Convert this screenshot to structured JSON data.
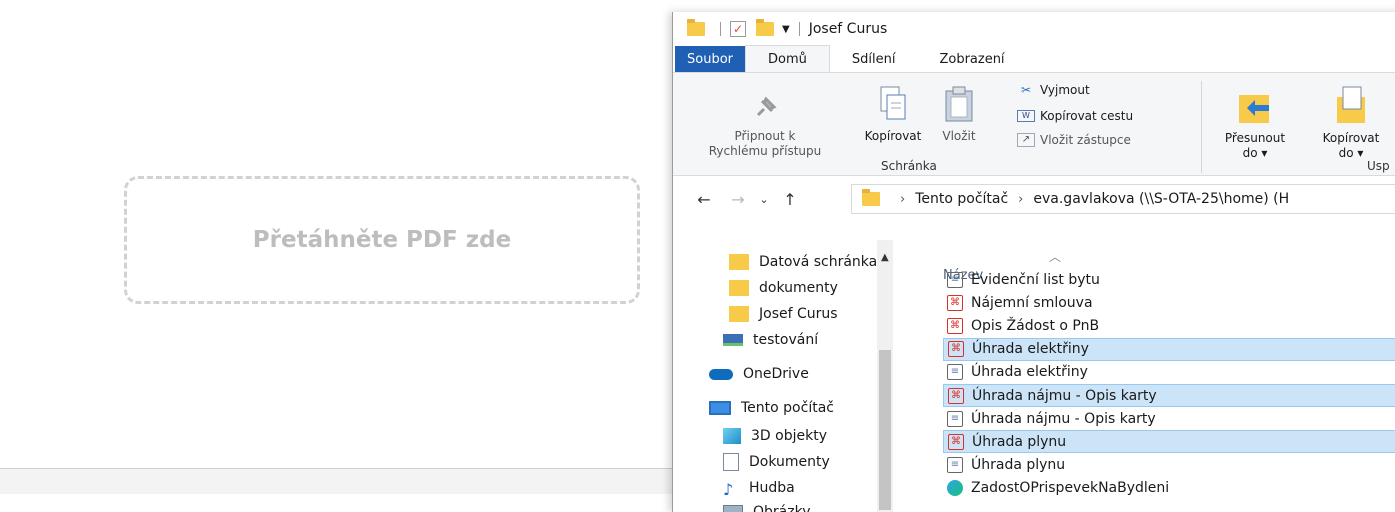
{
  "page": {
    "dropzone_label": "Přetáhněte PDF zde"
  },
  "explorer": {
    "title": "Josef Curus",
    "tabs": [
      "Soubor",
      "Domů",
      "Sdílení",
      "Zobrazení"
    ],
    "ribbon": {
      "pin_label_line1": "Připnout k",
      "pin_label_line2": "Rychlému přístupu",
      "copy_label": "Kopírovat",
      "paste_label": "Vložit",
      "cut_label": "Vyjmout",
      "copy_path_label": "Kopírovat cestu",
      "paste_shortcut_label": "Vložit zástupce",
      "clipboard_group": "Schránka",
      "move_to_line1": "Přesunout",
      "move_to_line2": "do ▾",
      "copy_to_line1": "Kopírovat",
      "copy_to_line2": "do ▾",
      "organize_group": "Usp"
    },
    "address": {
      "segment1": "Tento počítač",
      "segment2": "eva.gavlakova (\\\\S-OTA-25\\home) (H"
    },
    "nav_pane": [
      {
        "label": "Datová schránka",
        "icon": "folder-icon"
      },
      {
        "label": "dokumenty",
        "icon": "folder-icon"
      },
      {
        "label": "Josef Curus",
        "icon": "folder-icon"
      },
      {
        "label": "testování",
        "icon": "network-drive-icon"
      },
      {
        "label": "OneDrive",
        "icon": "cloud-icon"
      },
      {
        "label": "Tento počítač",
        "icon": "computer-icon"
      },
      {
        "label": "3D objekty",
        "icon": "cube-icon"
      },
      {
        "label": "Dokumenty",
        "icon": "document-icon"
      },
      {
        "label": "Hudba",
        "icon": "music-icon"
      },
      {
        "label": "Obrázky",
        "icon": "pictures-icon"
      }
    ],
    "column_header": "Název",
    "files": [
      {
        "name": "Evidenční list bytu",
        "type": "doc",
        "selected": false
      },
      {
        "name": "Nájemní smlouva",
        "type": "pdf",
        "selected": false
      },
      {
        "name": "Opis Žádost o PnB",
        "type": "pdf",
        "selected": false
      },
      {
        "name": "Úhrada elektřiny",
        "type": "pdf",
        "selected": true
      },
      {
        "name": "Úhrada elektřiny",
        "type": "doc",
        "selected": false
      },
      {
        "name": "Úhrada nájmu - Opis karty",
        "type": "pdf",
        "selected": true
      },
      {
        "name": "Úhrada nájmu - Opis karty",
        "type": "doc",
        "selected": false
      },
      {
        "name": "Úhrada plynu",
        "type": "pdf",
        "selected": true
      },
      {
        "name": "Úhrada plynu",
        "type": "doc",
        "selected": false
      },
      {
        "name": "ZadostOPrispevekNaBydleni",
        "type": "edge",
        "selected": false
      }
    ]
  }
}
